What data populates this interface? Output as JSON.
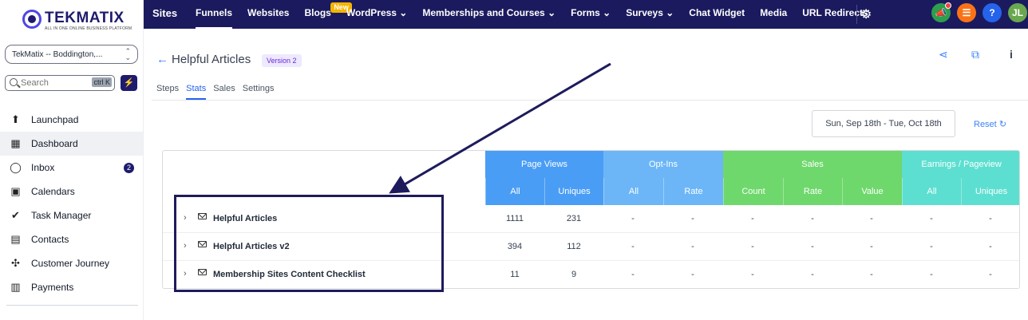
{
  "brand": {
    "name": "TEKMATIX",
    "tagline": "ALL IN ONE ONLINE BUSINESS PLATFORM"
  },
  "account": {
    "name": "TekMatix -- Boddington,..."
  },
  "search": {
    "placeholder": "Search",
    "shortcut": "ctrl K"
  },
  "sidebar": {
    "items": [
      {
        "label": "Launchpad",
        "icon": "launchpad-icon"
      },
      {
        "label": "Dashboard",
        "icon": "dashboard-icon",
        "active": true
      },
      {
        "label": "Inbox",
        "icon": "chat-icon",
        "badge": "2"
      },
      {
        "label": "Calendars",
        "icon": "calendar-icon"
      },
      {
        "label": "Task Manager",
        "icon": "check-circle-icon"
      },
      {
        "label": "Contacts",
        "icon": "contacts-icon"
      },
      {
        "label": "Customer Journey",
        "icon": "journey-icon"
      },
      {
        "label": "Payments",
        "icon": "payments-icon"
      }
    ]
  },
  "topbar": {
    "title": "Sites",
    "items": [
      {
        "label": "Funnels",
        "active": true
      },
      {
        "label": "Websites"
      },
      {
        "label": "Blogs",
        "badge": "New"
      },
      {
        "label": "WordPress",
        "dropdown": true
      },
      {
        "label": "Memberships and Courses",
        "dropdown": true
      },
      {
        "label": "Forms",
        "dropdown": true
      },
      {
        "label": "Surveys",
        "dropdown": true
      },
      {
        "label": "Chat Widget"
      },
      {
        "label": "Media"
      },
      {
        "label": "URL Redirects"
      }
    ],
    "avatar_initials": "JL",
    "colors": {
      "bar": "#1b1a5e",
      "green": "#2e9e4d",
      "orange": "#f97316",
      "blue": "#2563eb"
    }
  },
  "page": {
    "title": "Helpful Articles",
    "version": "Version 2"
  },
  "tabs": [
    {
      "label": "Steps"
    },
    {
      "label": "Stats",
      "active": true
    },
    {
      "label": "Sales"
    },
    {
      "label": "Settings"
    }
  ],
  "date_range": "Sun, Sep 18th - Tue, Oct 18th",
  "reset_label": "Reset",
  "table": {
    "groups": [
      {
        "label": "Page Views",
        "color": "#4a9df5"
      },
      {
        "label": "Opt-Ins",
        "color": "#6cb6f7"
      },
      {
        "label": "Sales",
        "color": "#6ed86c"
      },
      {
        "label": "Earnings / Pageview",
        "color": "#5cdfd0"
      }
    ],
    "subheaders": [
      "All",
      "Uniques",
      "All",
      "Rate",
      "Count",
      "Rate",
      "Value",
      "All",
      "Uniques"
    ],
    "rows": [
      {
        "name": "Helpful Articles",
        "values": [
          "1111",
          "231",
          "-",
          "-",
          "-",
          "-",
          "-",
          "-",
          "-"
        ]
      },
      {
        "name": "Helpful Articles v2",
        "values": [
          "394",
          "112",
          "-",
          "-",
          "-",
          "-",
          "-",
          "-",
          "-"
        ]
      },
      {
        "name": "Membership Sites Content Checklist",
        "values": [
          "11",
          "9",
          "-",
          "-",
          "-",
          "-",
          "-",
          "-",
          "-"
        ]
      }
    ]
  }
}
